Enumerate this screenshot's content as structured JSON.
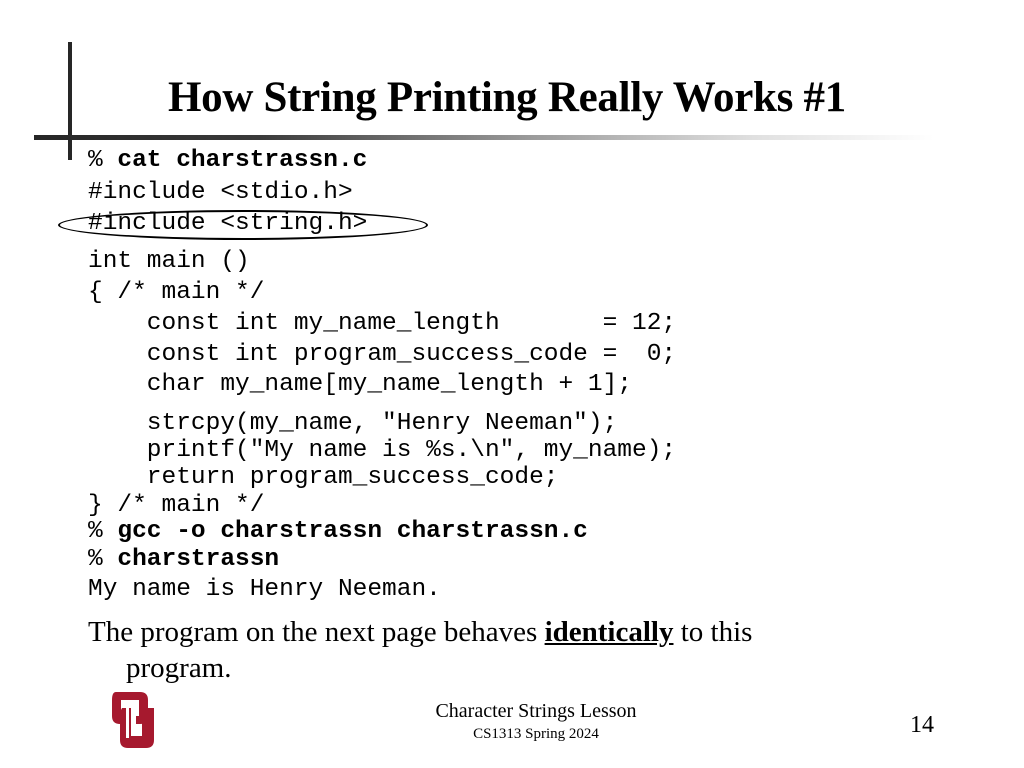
{
  "slide": {
    "title": "How String Printing Really Works #1",
    "code_lines": [
      {
        "prompt": "% ",
        "text": "cat charstrassn.c",
        "bold": true
      },
      {
        "prompt": "",
        "text": "#include <stdio.h>",
        "bold": false
      },
      {
        "prompt": "",
        "text": "#include <string.h>",
        "bold": false,
        "circled": true
      },
      {
        "prompt": "",
        "text": "int main ()",
        "bold": false
      },
      {
        "prompt": "",
        "text": "{ /* main */",
        "bold": false
      },
      {
        "prompt": "",
        "text": "    const int my_name_length       = 12;",
        "bold": false
      },
      {
        "prompt": "",
        "text": "    const int program_success_code =  0;",
        "bold": false
      },
      {
        "prompt": "",
        "text": "    char my_name[my_name_length + 1];",
        "bold": false
      },
      {
        "prompt": "",
        "text": "    strcpy(my_name, \"Henry Neeman\");",
        "bold": false
      },
      {
        "prompt": "",
        "text": "    printf(\"My name is %s.\\n\", my_name);",
        "bold": false
      },
      {
        "prompt": "",
        "text": "    return program_success_code;",
        "bold": false
      },
      {
        "prompt": "",
        "text": "} /* main */",
        "bold": false
      },
      {
        "prompt": "% ",
        "text": "gcc -o charstrassn charstrassn.c",
        "bold": true
      },
      {
        "prompt": "% ",
        "text": "charstrassn",
        "bold": true
      },
      {
        "prompt": "",
        "text": "My name is Henry Neeman.",
        "bold": false
      }
    ],
    "bullet": {
      "before": "The program on the next page behaves ",
      "emphasis": "identically",
      "after": " to this",
      "continuation": "program."
    }
  },
  "footer": {
    "lesson_title": "Character Strings Lesson",
    "course": "CS1313 Spring 2024",
    "page_number": "14",
    "logo": "ou-logo",
    "logo_color": "#A6192E"
  }
}
